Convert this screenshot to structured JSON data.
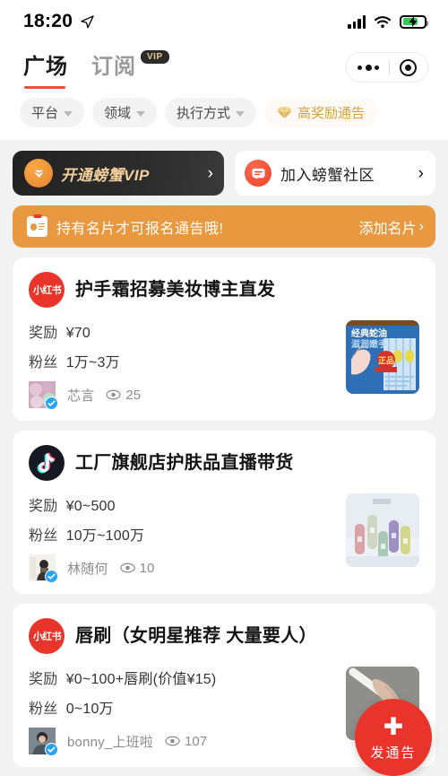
{
  "statusbar": {
    "time": "18:20",
    "location_icon": "location-arrow-icon",
    "signal_icon": "cellular-signal-icon",
    "wifi_icon": "wifi-icon",
    "battery_icon": "battery-charging-icon"
  },
  "header": {
    "tabs": [
      {
        "label": "广场",
        "active": true,
        "badge": null
      },
      {
        "label": "订阅",
        "active": false,
        "badge": "VIP"
      }
    ],
    "capsule": {
      "menu_icon": "more-dots-icon",
      "target_icon": "target-circle-icon"
    }
  },
  "filters": [
    {
      "label": "平台",
      "type": "dropdown"
    },
    {
      "label": "领域",
      "type": "dropdown"
    },
    {
      "label": "执行方式",
      "type": "dropdown"
    },
    {
      "label": "高奖励通告",
      "type": "highlight",
      "icon": "diamond-icon",
      "color": "#d8a13c"
    }
  ],
  "promo": {
    "vip_banner": {
      "label": "开通螃蟹VIP",
      "icon": "crab-vip-diamond-icon",
      "chevron": "›"
    },
    "community": {
      "label": "加入螃蟹社区",
      "icon": "chat-bubble-icon",
      "chevron": "›"
    }
  },
  "notice": {
    "icon": "id-card-icon",
    "text": "持有名片才可报名通告哦!",
    "action": "添加名片",
    "chevron": "›",
    "bg_color": "#e8993f"
  },
  "cards": [
    {
      "platform": "xiaohongshu",
      "platform_label": "小红书",
      "title": "护手霜招募美妆博主直发",
      "reward_label": "奖励",
      "reward_value": "¥70",
      "fans_label": "粉丝",
      "fans_value": "1万~3万",
      "username": "芯言",
      "verified": true,
      "views_icon": "eye-icon",
      "views": "25",
      "thumb_alt": "经典蛇油滋润嫩手护手霜产品图"
    },
    {
      "platform": "douyin",
      "platform_label": "抖音",
      "title": "工厂旗舰店护肤品直播带货",
      "reward_label": "奖励",
      "reward_value": "¥0~500",
      "fans_label": "粉丝",
      "fans_value": "10万~100万",
      "username": "林随何",
      "verified": true,
      "views_icon": "eye-icon",
      "views": "10",
      "thumb_alt": "彩色护肤品瓶子组合产品图"
    },
    {
      "platform": "xiaohongshu",
      "platform_label": "小红书",
      "title": "唇刷（女明星推荐 大量要人）",
      "reward_label": "奖励",
      "reward_value": "¥0~100+唇刷(价值¥15)",
      "fans_label": "粉丝",
      "fans_value": "0~10万",
      "username": "bonny_上班啦",
      "verified": true,
      "views_icon": "eye-icon",
      "views": "107",
      "thumb_alt": "手持白色唇刷产品图"
    }
  ],
  "fab": {
    "icon": "plus-icon",
    "label": "发通告",
    "color": "#e8342a"
  }
}
